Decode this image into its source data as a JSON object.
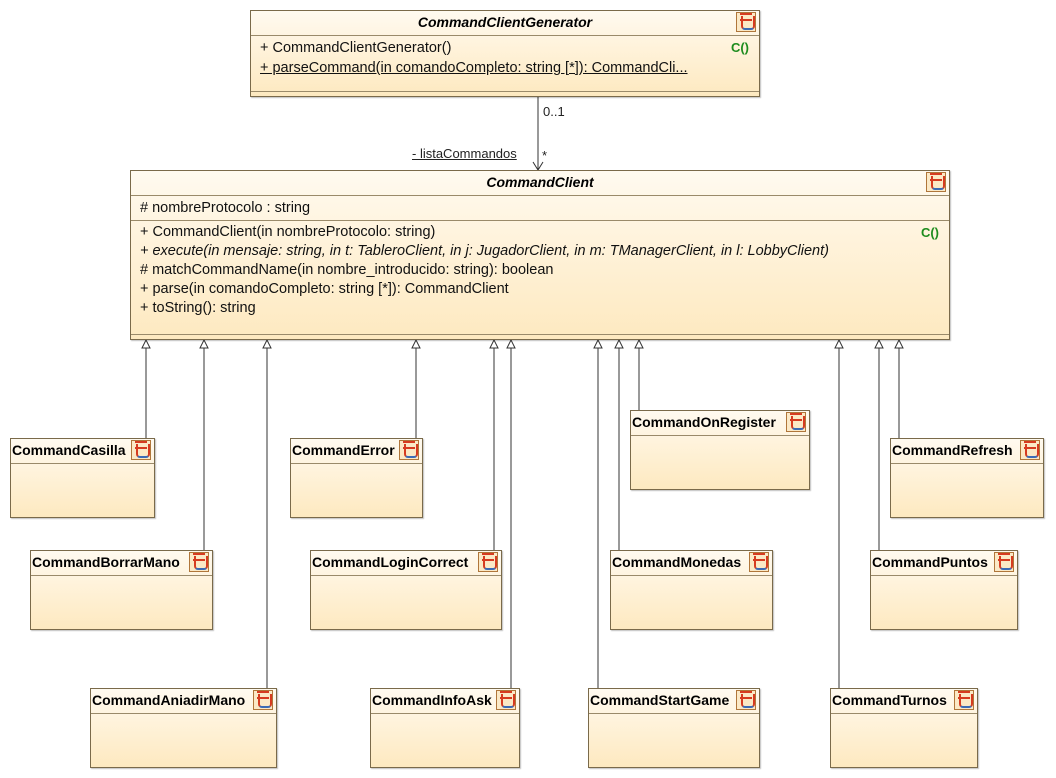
{
  "generator": {
    "name": "CommandClientGenerator",
    "ops": [
      {
        "text": "+ CommandClientGenerator()",
        "ctor": "C()"
      },
      {
        "text": "+ parseCommand(in comandoCompleto: string [*]): CommandCli..."
      }
    ]
  },
  "association": {
    "multiplicity_source": "0..1",
    "role": "- listaCommandos",
    "multiplicity_target": "*"
  },
  "client": {
    "name": "CommandClient",
    "attrs": [
      "# nombreProtocolo : string"
    ],
    "ops": [
      {
        "text": "+ CommandClient(in nombreProtocolo: string)",
        "ctor": "C()"
      },
      {
        "text": "+ execute(in mensaje: string, in t: TableroClient, in j: JugadorClient, in m: TManagerClient, in l: LobbyClient)"
      },
      {
        "text": "# matchCommandName(in nombre_introducido: string): boolean"
      },
      {
        "text": "+ parse(in comandoCompleto: string [*]): CommandClient"
      },
      {
        "text": "+ toString(): string"
      }
    ]
  },
  "subclasses": [
    {
      "name": "CommandCasilla"
    },
    {
      "name": "CommandBorrarMano"
    },
    {
      "name": "CommandAniadirMano"
    },
    {
      "name": "CommandError"
    },
    {
      "name": "CommandLoginCorrect"
    },
    {
      "name": "CommandInfoAsk"
    },
    {
      "name": "CommandOnRegister"
    },
    {
      "name": "CommandMonedas"
    },
    {
      "name": "CommandStartGame"
    },
    {
      "name": "CommandRefresh"
    },
    {
      "name": "CommandPuntos"
    },
    {
      "name": "CommandTurnos"
    }
  ]
}
